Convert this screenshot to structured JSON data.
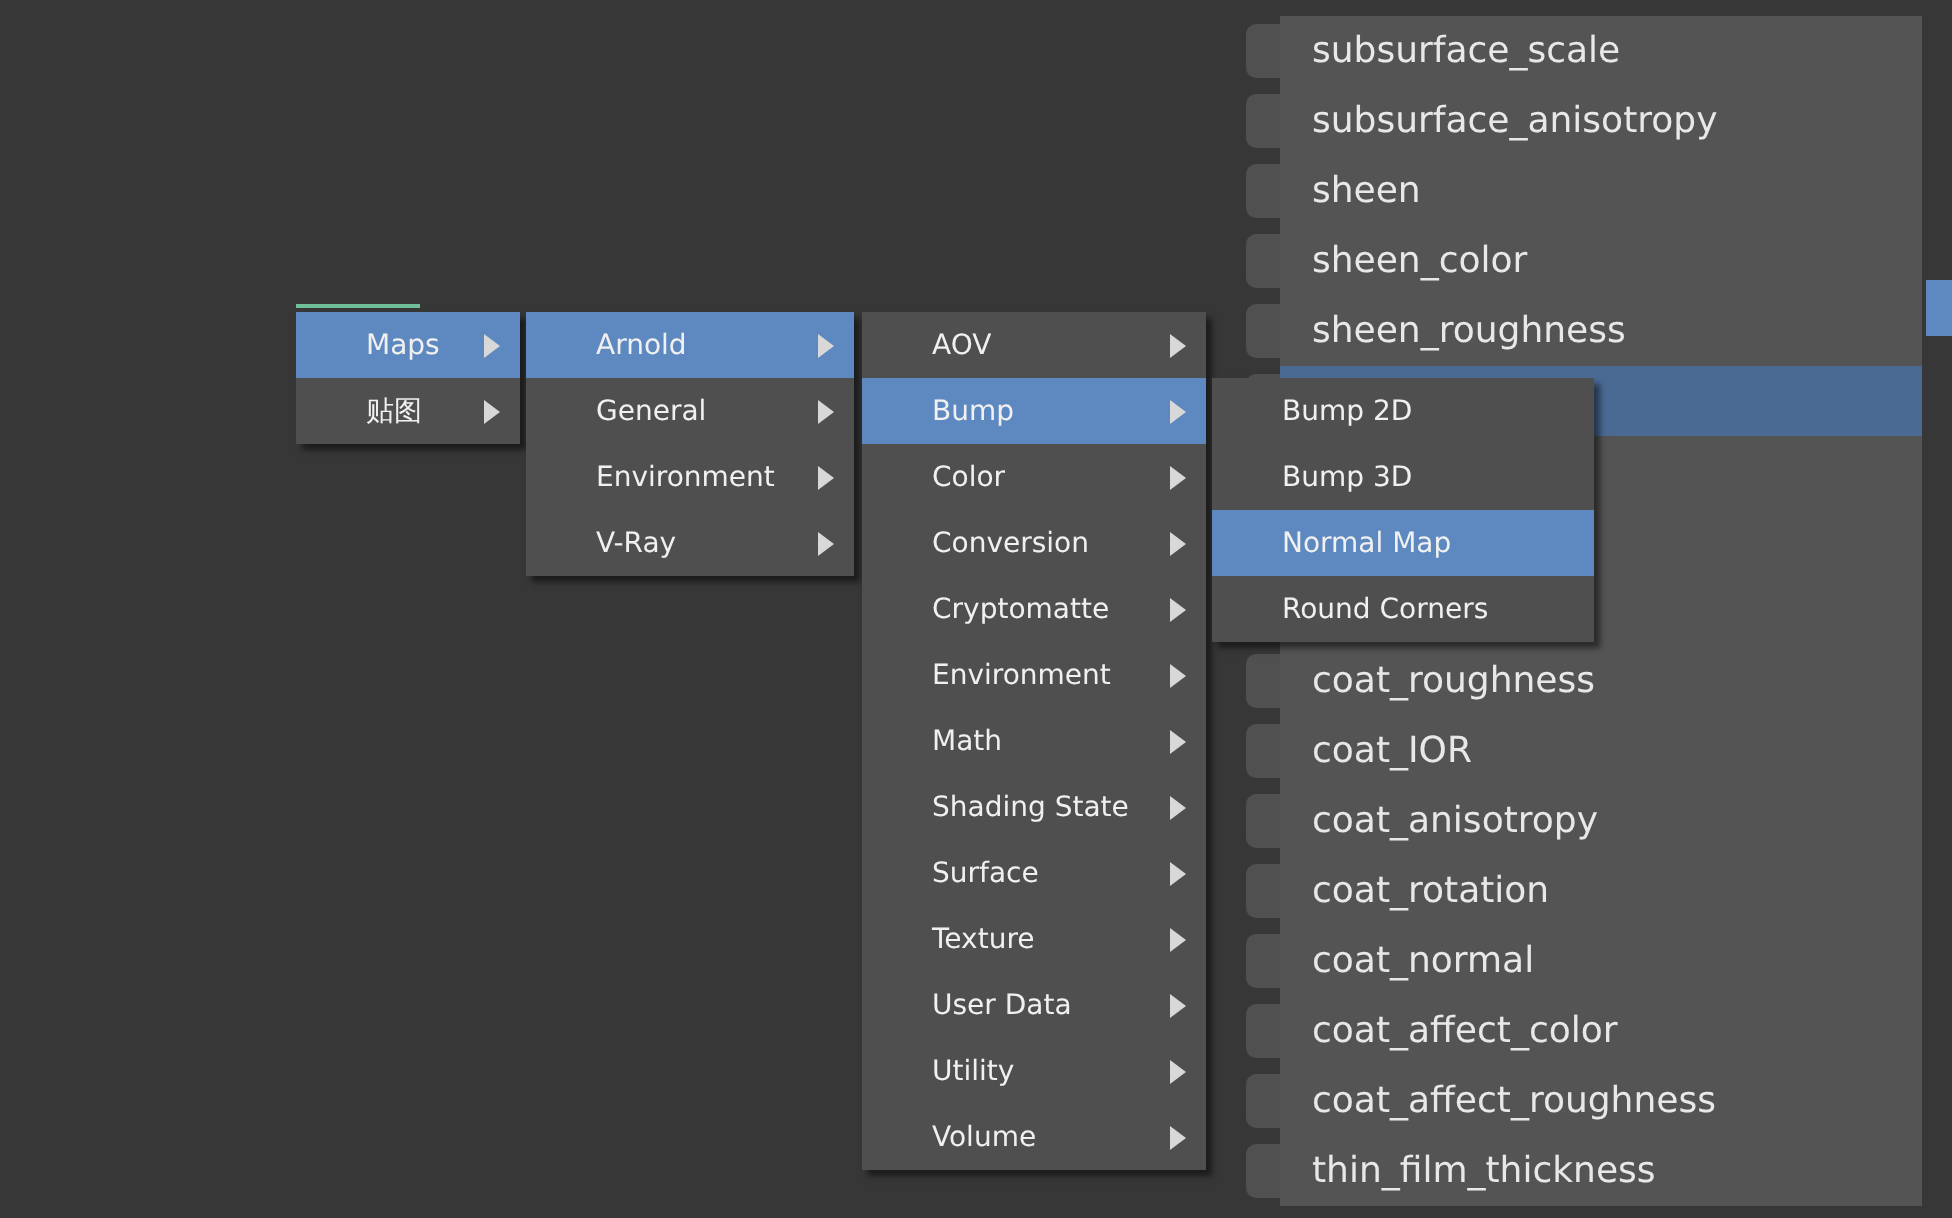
{
  "node_panel": {
    "rows": [
      {
        "label": "subsurface_scale",
        "selected": false
      },
      {
        "label": "subsurface_anisotropy",
        "selected": false
      },
      {
        "label": "sheen",
        "selected": false
      },
      {
        "label": "sheen_color",
        "selected": false
      },
      {
        "label": "sheen_roughness",
        "selected": false
      },
      {
        "selected": true
      },
      {
        "selected": false
      },
      {
        "selected": false
      },
      {
        "selected": false
      },
      {
        "label": "coat_roughness",
        "selected": false
      },
      {
        "label": "coat_IOR",
        "selected": false
      },
      {
        "label": "coat_anisotropy",
        "selected": false
      },
      {
        "label": "coat_rotation",
        "selected": false
      },
      {
        "label": "coat_normal",
        "selected": false
      },
      {
        "label": "coat_affect_color",
        "selected": false
      },
      {
        "label": "coat_affect_roughness",
        "selected": false
      },
      {
        "label": "thin_film_thickness",
        "selected": false
      }
    ]
  },
  "menus": [
    {
      "items": [
        {
          "label": "Maps",
          "submenu": true,
          "selected": true
        },
        {
          "label": "贴图",
          "submenu": true,
          "selected": false
        }
      ]
    },
    {
      "items": [
        {
          "label": "Arnold",
          "submenu": true,
          "selected": true
        },
        {
          "label": "General",
          "submenu": true,
          "selected": false
        },
        {
          "label": "Environment",
          "submenu": true,
          "selected": false
        },
        {
          "label": "V-Ray",
          "submenu": true,
          "selected": false
        }
      ]
    },
    {
      "items": [
        {
          "label": "AOV",
          "submenu": true,
          "selected": false
        },
        {
          "label": "Bump",
          "submenu": true,
          "selected": true
        },
        {
          "label": "Color",
          "submenu": true,
          "selected": false
        },
        {
          "label": "Conversion",
          "submenu": true,
          "selected": false
        },
        {
          "label": "Cryptomatte",
          "submenu": true,
          "selected": false
        },
        {
          "label": "Environment",
          "submenu": true,
          "selected": false
        },
        {
          "label": "Math",
          "submenu": true,
          "selected": false
        },
        {
          "label": "Shading State",
          "submenu": true,
          "selected": false
        },
        {
          "label": "Surface",
          "submenu": true,
          "selected": false
        },
        {
          "label": "Texture",
          "submenu": true,
          "selected": false
        },
        {
          "label": "User Data",
          "submenu": true,
          "selected": false
        },
        {
          "label": "Utility",
          "submenu": true,
          "selected": false
        },
        {
          "label": "Volume",
          "submenu": true,
          "selected": false
        }
      ]
    },
    {
      "items": [
        {
          "label": "Bump 2D",
          "submenu": false,
          "selected": false
        },
        {
          "label": "Bump 3D",
          "submenu": false,
          "selected": false
        },
        {
          "label": "Normal Map",
          "submenu": false,
          "selected": true
        },
        {
          "label": "Round Corners",
          "submenu": false,
          "selected": false
        }
      ]
    }
  ]
}
